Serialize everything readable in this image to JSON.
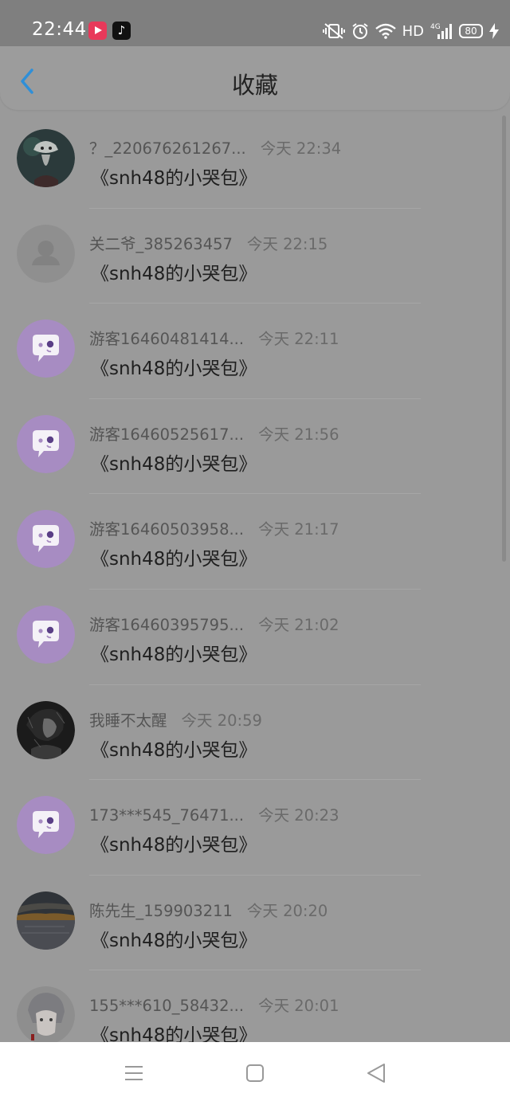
{
  "status_bar": {
    "time": "22:44",
    "network_label": "HD",
    "signal_label": "4G",
    "battery_level": "80",
    "icons": [
      "video-app-icon",
      "tiktok-icon",
      "vibrate-mute-icon",
      "alarm-icon",
      "wifi-icon",
      "cell-signal-icon",
      "battery-icon",
      "charging-icon"
    ]
  },
  "header": {
    "title": "收藏",
    "back_icon": "chevron-left-icon"
  },
  "colors": {
    "accent": "#2f8fd8",
    "overlay_bg": "#9a9a9a",
    "guest_avatar": "#a78cc2"
  },
  "favorites": [
    {
      "user": "？_220676261267...",
      "time": "今天 22:34",
      "title": "《snh48的小哭包》",
      "avatar": "photo-ghost"
    },
    {
      "user": "关二爷_385263457",
      "time": "今天 22:15",
      "title": "《snh48的小哭包》",
      "avatar": "default-person"
    },
    {
      "user": "游客16460481414...",
      "time": "今天 22:11",
      "title": "《snh48的小哭包》",
      "avatar": "guest-chat"
    },
    {
      "user": "游客16460525617...",
      "time": "今天 21:56",
      "title": "《snh48的小哭包》",
      "avatar": "guest-chat"
    },
    {
      "user": "游客16460503958...",
      "time": "今天 21:17",
      "title": "《snh48的小哭包》",
      "avatar": "guest-chat"
    },
    {
      "user": "游客16460395795...",
      "time": "今天 21:02",
      "title": "《snh48的小哭包》",
      "avatar": "guest-chat"
    },
    {
      "user": "我睡不太醒",
      "time": "今天 20:59",
      "title": "《snh48的小哭包》",
      "avatar": "photo-dark-sketch"
    },
    {
      "user": "173***545_76471...",
      "time": "今天 20:23",
      "title": "《snh48的小哭包》",
      "avatar": "guest-chat"
    },
    {
      "user": "陈先生_159903211",
      "time": "今天 20:20",
      "title": "《snh48的小哭包》",
      "avatar": "photo-sunset"
    },
    {
      "user": "155***610_58432...",
      "time": "今天 20:01",
      "title": "《snh48的小哭包》",
      "avatar": "photo-anime"
    }
  ],
  "nav_bar": {
    "icons": [
      "menu-icon",
      "home-square-icon",
      "back-triangle-icon"
    ]
  }
}
